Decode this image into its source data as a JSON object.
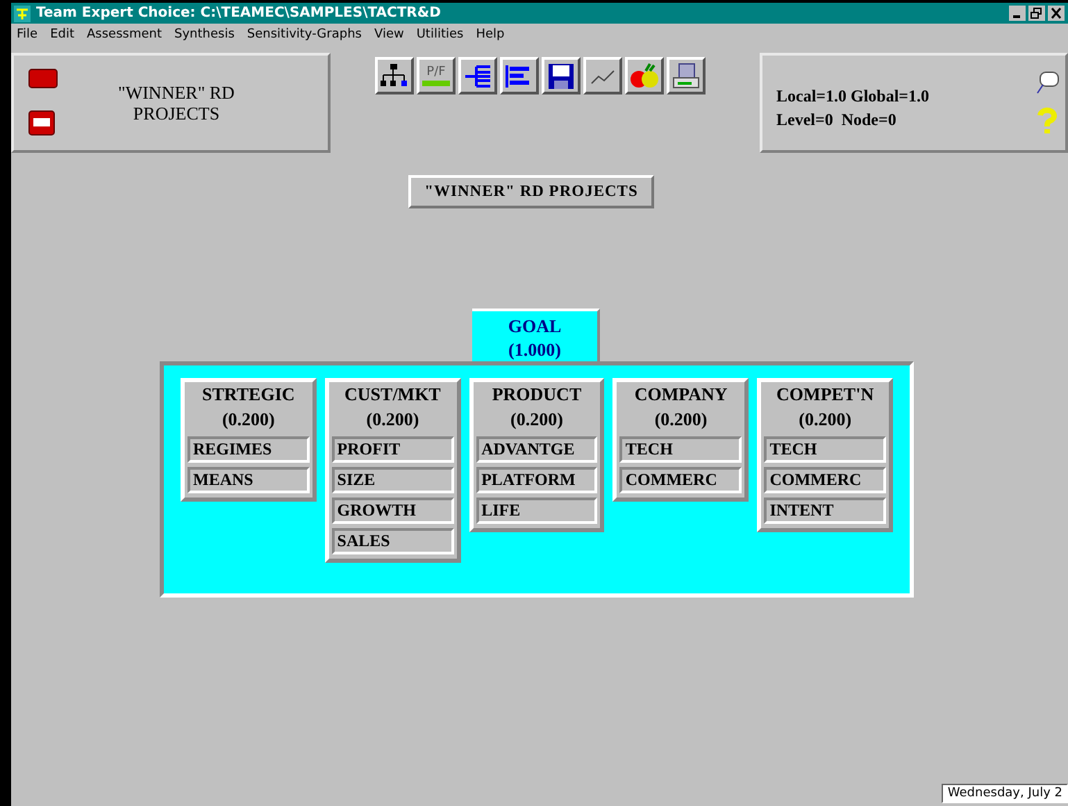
{
  "window": {
    "title": "Team Expert Choice: C:\\TEAMEC\\SAMPLES\\TACTR&D"
  },
  "menu": [
    "File",
    "Edit",
    "Assessment",
    "Synthesis",
    "Sensitivity-Graphs",
    "View",
    "Utilities",
    "Help"
  ],
  "model_panel": {
    "name": "\"WINNER\" RD PROJECTS"
  },
  "toolbar": [
    {
      "kind": "tree"
    },
    {
      "kind": "pf",
      "label": "P/F"
    },
    {
      "kind": "branch"
    },
    {
      "kind": "bars"
    },
    {
      "kind": "save"
    },
    {
      "kind": "graph"
    },
    {
      "kind": "fruit"
    },
    {
      "kind": "print"
    }
  ],
  "info_panel": {
    "line_1": "Local=1.0 Global=1.0",
    "line_2": "Level=0  Node=0"
  },
  "title_box": "\"WINNER\" RD PROJECTS",
  "goal": {
    "name": "GOAL",
    "priority": "(1.000)"
  },
  "criteria": [
    {
      "name": "STRTEGIC",
      "priority": "(0.200)",
      "children": [
        {
          "name": "REGIMES"
        },
        {
          "name": "MEANS"
        }
      ]
    },
    {
      "name": "CUST/MKT",
      "priority": "(0.200)",
      "children": [
        {
          "name": "PROFIT"
        },
        {
          "name": "SIZE"
        },
        {
          "name": "GROWTH"
        },
        {
          "name": "SALES"
        }
      ]
    },
    {
      "name": "PRODUCT",
      "priority": "(0.200)",
      "children": [
        {
          "name": "ADVANTGE"
        },
        {
          "name": "PLATFORM"
        },
        {
          "name": "LIFE"
        }
      ]
    },
    {
      "name": "COMPANY",
      "priority": "(0.200)",
      "children": [
        {
          "name": "TECH"
        },
        {
          "name": "COMMERC"
        }
      ]
    },
    {
      "name": "COMPET'N",
      "priority": "(0.200)",
      "children": [
        {
          "name": "TECH"
        },
        {
          "name": "COMMERC"
        },
        {
          "name": "INTENT"
        }
      ]
    }
  ],
  "status_bar": {
    "date": "Wednesday, July 2"
  }
}
